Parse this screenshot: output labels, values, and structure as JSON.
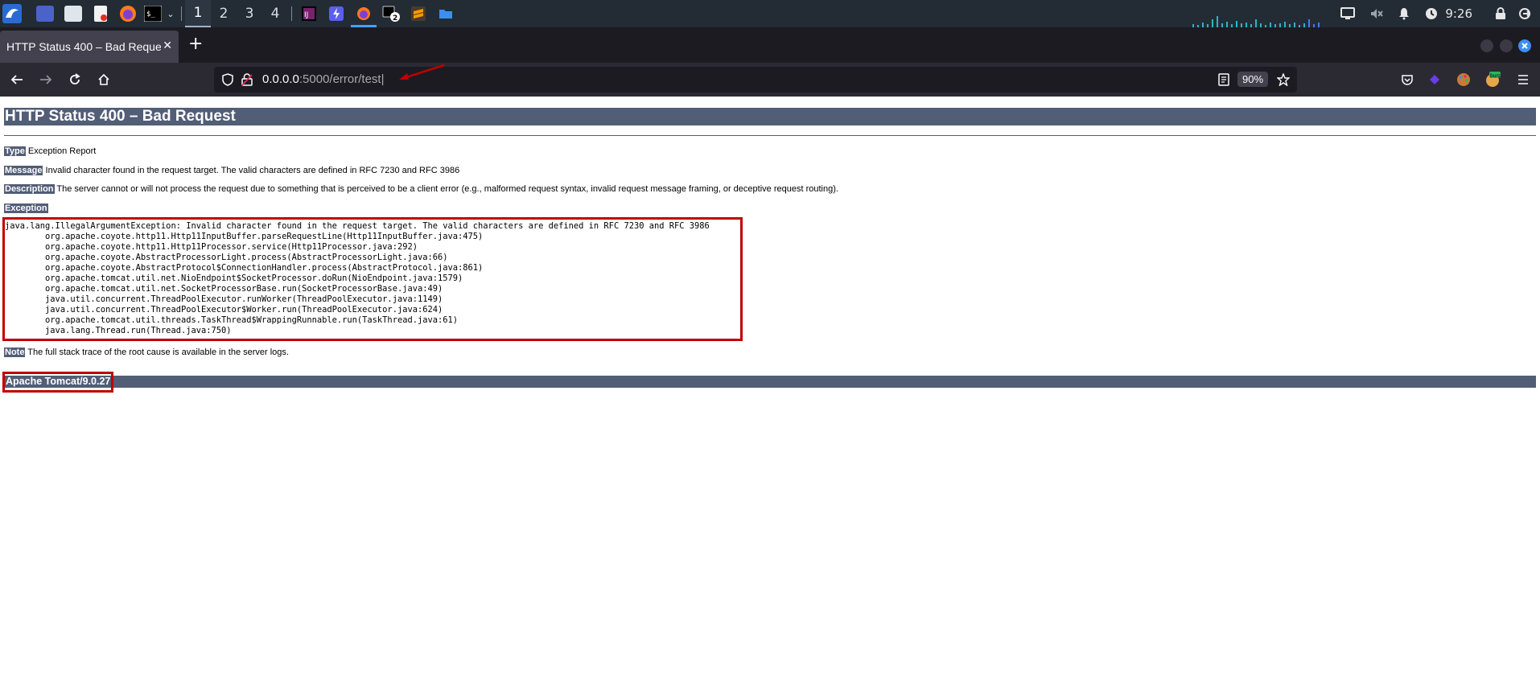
{
  "taskbar": {
    "workspaces": [
      "1",
      "2",
      "3",
      "4"
    ],
    "active_workspace": "1",
    "clock": "9:26",
    "badge_count": "2"
  },
  "browser": {
    "tab_title": "HTTP Status 400 – Bad Request",
    "url_host": "0.0.0.0",
    "url_path": ":5000/error/test|",
    "zoom": "90%",
    "ext_label": "burp"
  },
  "page": {
    "title": "HTTP Status 400 – Bad Request",
    "type_label": "Type",
    "type_value": " Exception Report",
    "message_label": "Message",
    "message_value": " Invalid character found in the request target. The valid characters are defined in RFC 7230 and RFC 3986",
    "description_label": "Description",
    "description_value": " The server cannot or will not process the request due to something that is perceived to be a client error (e.g., malformed request syntax, invalid request message framing, or deceptive request routing).",
    "exception_label": "Exception",
    "stack_trace": "java.lang.IllegalArgumentException: Invalid character found in the request target. The valid characters are defined in RFC 7230 and RFC 3986\n\torg.apache.coyote.http11.Http11InputBuffer.parseRequestLine(Http11InputBuffer.java:475)\n\torg.apache.coyote.http11.Http11Processor.service(Http11Processor.java:292)\n\torg.apache.coyote.AbstractProcessorLight.process(AbstractProcessorLight.java:66)\n\torg.apache.coyote.AbstractProtocol$ConnectionHandler.process(AbstractProtocol.java:861)\n\torg.apache.tomcat.util.net.NioEndpoint$SocketProcessor.doRun(NioEndpoint.java:1579)\n\torg.apache.tomcat.util.net.SocketProcessorBase.run(SocketProcessorBase.java:49)\n\tjava.util.concurrent.ThreadPoolExecutor.runWorker(ThreadPoolExecutor.java:1149)\n\tjava.util.concurrent.ThreadPoolExecutor$Worker.run(ThreadPoolExecutor.java:624)\n\torg.apache.tomcat.util.threads.TaskThread$WrappingRunnable.run(TaskThread.java:61)\n\tjava.lang.Thread.run(Thread.java:750)",
    "note_label": "Note",
    "note_value": " The full stack trace of the root cause is available in the server logs.",
    "server_version": "Apache Tomcat/9.0.27"
  },
  "colors": {
    "tomcat_header": "#525d76",
    "annotation_red": "#c00000",
    "taskbar_bg": "#232b34",
    "browser_bg": "#2b2a33"
  }
}
